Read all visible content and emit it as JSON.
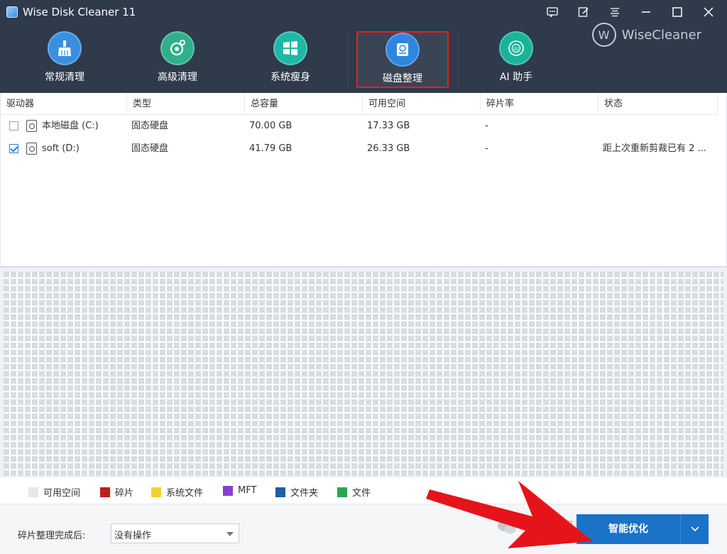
{
  "window": {
    "title": "Wise Disk Cleaner 11"
  },
  "title_controls": [
    {
      "name": "feedback-icon"
    },
    {
      "name": "edit-icon"
    },
    {
      "name": "menu-icon"
    },
    {
      "name": "minimize-icon"
    },
    {
      "name": "maximize-icon"
    },
    {
      "name": "close-icon"
    }
  ],
  "nav": {
    "items": [
      {
        "label": "常规清理",
        "color": "#3a8fe0"
      },
      {
        "label": "高级清理",
        "color": "#2fb08a"
      },
      {
        "label": "系统瘦身",
        "color": "#1fb7a6"
      },
      {
        "label": "磁盘整理",
        "color": "#2e86de",
        "active": true
      },
      {
        "label": "AI 助手",
        "color": "#19b39a"
      }
    ]
  },
  "brand": {
    "logo_letter": "W",
    "name": "WiseCleaner"
  },
  "table": {
    "columns": [
      "驱动器",
      "类型",
      "总容量",
      "可用空间",
      "碎片率",
      "状态"
    ],
    "rows": [
      {
        "checked": false,
        "drive": "本地磁盘 (C:)",
        "type": "固态硬盘",
        "total": "70.00 GB",
        "free": "17.33 GB",
        "frag": "-",
        "status": ""
      },
      {
        "checked": true,
        "drive": "soft (D:)",
        "type": "固态硬盘",
        "total": "41.79 GB",
        "free": "26.33 GB",
        "frag": "-",
        "status": "距上次重新剪裁已有 2 ..."
      }
    ]
  },
  "legend": [
    {
      "label": "可用空间",
      "color": "#e6e8ec"
    },
    {
      "label": "碎片",
      "color": "#c21d1d"
    },
    {
      "label": "系统文件",
      "color": "#f4d22b"
    },
    {
      "label": "MFT",
      "color": "#8a3fd1"
    },
    {
      "label": "文件夹",
      "color": "#1f5ea8"
    },
    {
      "label": "文件",
      "color": "#2ea44f"
    }
  ],
  "footer": {
    "after_label": "碎片整理完成后:",
    "after_value": "没有操作",
    "watermark": "公众号 · 科技瞎鼓捣",
    "primary_button": "智能优化"
  },
  "colors": {
    "header": "#2f3a4b",
    "accent": "#1a72c9",
    "highlight": "#e02222"
  }
}
